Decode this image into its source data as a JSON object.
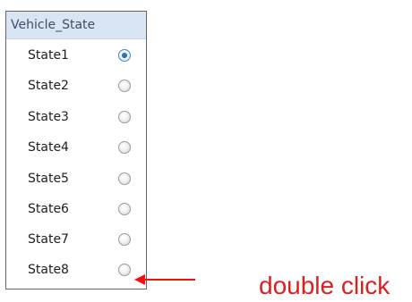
{
  "panel": {
    "title": "Vehicle_State",
    "selected_state": "State1",
    "items": [
      {
        "label": "State1",
        "checked": true
      },
      {
        "label": "State2",
        "checked": false
      },
      {
        "label": "State3",
        "checked": false
      },
      {
        "label": "State4",
        "checked": false
      },
      {
        "label": "State5",
        "checked": false
      },
      {
        "label": "State6",
        "checked": false
      },
      {
        "label": "State7",
        "checked": false
      },
      {
        "label": "State8",
        "checked": false
      }
    ]
  },
  "annotation": {
    "text": "double click",
    "color": "#dd1f1f",
    "arrow_color": "#ee1212"
  },
  "colors": {
    "header_background": "#d8e5f2",
    "border": "#646464",
    "selected_radio": "#2f74b5"
  },
  "icons": {
    "radio_checked": "radio-checked-icon",
    "radio_unchecked": "radio-unchecked-icon",
    "annotation_arrow": "left-arrow-icon"
  }
}
